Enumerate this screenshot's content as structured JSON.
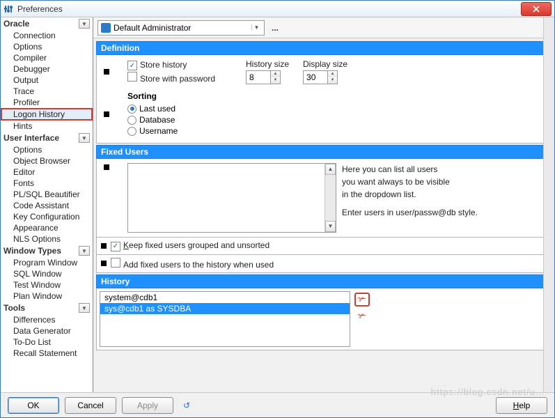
{
  "window": {
    "title": "Preferences"
  },
  "sidebar": {
    "categories": [
      {
        "label": "Oracle",
        "items": [
          "Connection",
          "Options",
          "Compiler",
          "Debugger",
          "Output",
          "Trace",
          "Profiler",
          "Logon History",
          "Hints"
        ],
        "selected": 7
      },
      {
        "label": "User Interface",
        "items": [
          "Options",
          "Object Browser",
          "Editor",
          "Fonts",
          "PL/SQL Beautifier",
          "Code Assistant",
          "Key Configuration",
          "Appearance",
          "NLS Options"
        ]
      },
      {
        "label": "Window Types",
        "items": [
          "Program Window",
          "SQL Window",
          "Test Window",
          "Plan Window"
        ]
      },
      {
        "label": "Tools",
        "items": [
          "Differences",
          "Data Generator",
          "To-Do List",
          "Recall Statement"
        ]
      }
    ]
  },
  "toolbar": {
    "admin": "Default Administrator",
    "more": "..."
  },
  "definition": {
    "title": "Definition",
    "store_history": "Store history",
    "store_password": "Store with password",
    "history_size_label": "History size",
    "history_size": "8",
    "display_size_label": "Display size",
    "display_size": "30",
    "sorting": "Sorting",
    "opt1": "Last used",
    "opt2": "Database",
    "opt3": "Username"
  },
  "fixed": {
    "title": "Fixed Users",
    "help1": "Here you can list all users",
    "help2": "you want always to be visible",
    "help3": "in the dropdown list.",
    "help4": "Enter users in user/passw@db style.",
    "keep": "Keep fixed users grouped and unsorted",
    "add": "Add fixed users to the history when used"
  },
  "history": {
    "title": "History",
    "items": [
      "system@cdb1",
      "sys@cdb1 as SYSDBA"
    ],
    "selected": 1
  },
  "footer": {
    "ok": "OK",
    "cancel": "Cancel",
    "apply": "Apply",
    "help": "Help"
  },
  "watermark": "https://blog.csdn.net/u…"
}
